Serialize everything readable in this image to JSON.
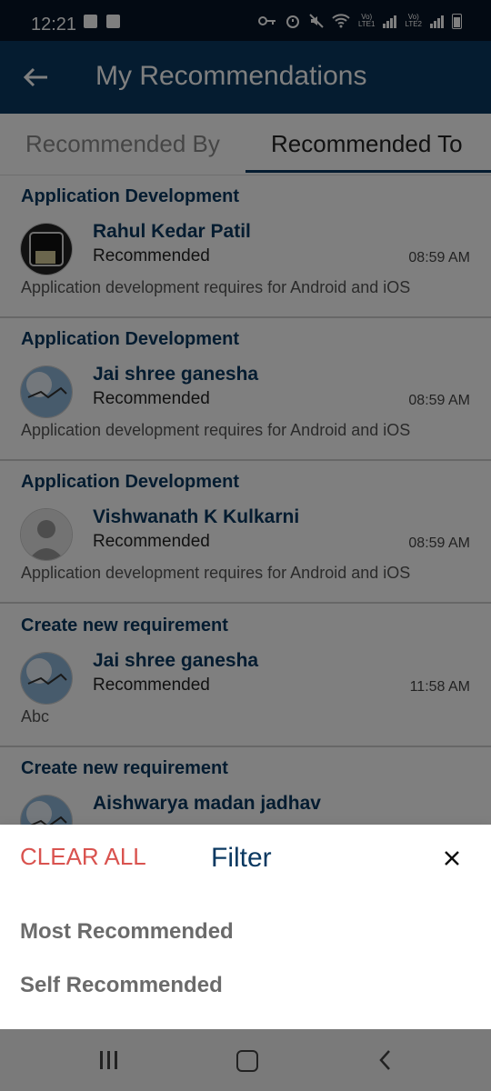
{
  "status_bar": {
    "time": "12:21"
  },
  "app_bar": {
    "title": "My Recommendations"
  },
  "tabs": [
    {
      "label": "Recommended By",
      "active": false
    },
    {
      "label": "Recommended To",
      "active": true
    }
  ],
  "cards": [
    {
      "heading": "Application Development",
      "name": "Rahul Kedar Patil",
      "status": "Recommended",
      "time": "08:59 AM",
      "description": "Application development requires for Android and iOS",
      "avatar": "photo"
    },
    {
      "heading": "Application Development",
      "name": "Jai shree ganesha",
      "status": "Recommended",
      "time": "08:59 AM",
      "description": "Application development requires for Android and iOS",
      "avatar": "sky"
    },
    {
      "heading": "Application Development",
      "name": "Vishwanath K Kulkarni",
      "status": "Recommended",
      "time": "08:59 AM",
      "description": "Application development requires for Android and iOS",
      "avatar": "default-person"
    },
    {
      "heading": "Create new requirement",
      "name": "Jai shree ganesha",
      "status": "Recommended",
      "time": "11:58 AM",
      "description": "Abc",
      "avatar": "sky"
    },
    {
      "heading": "Create new requirement",
      "name": "Aishwarya madan jadhav",
      "status": "",
      "time": "",
      "description": "",
      "avatar": "sky"
    }
  ],
  "filter_sheet": {
    "clear_all": "CLEAR ALL",
    "title": "Filter",
    "options": [
      "Most Recommended",
      "Self Recommended"
    ]
  },
  "colors": {
    "primary": "#0b3961",
    "clear_all": "#d9534f"
  }
}
